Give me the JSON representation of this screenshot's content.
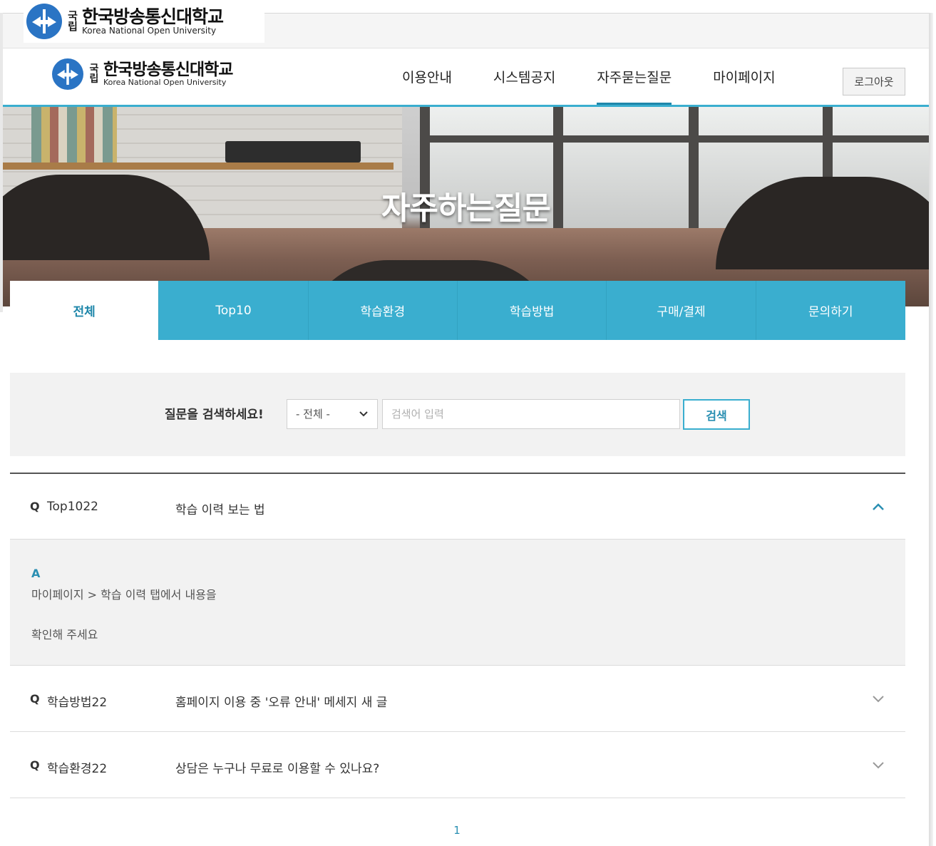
{
  "logo": {
    "korean": "한국방송통신대학교",
    "english": "Korea National Open University",
    "guklip": "국립"
  },
  "nav": {
    "items": [
      "이용안내",
      "시스템공지",
      "자주묻는질문",
      "마이페이지"
    ],
    "active_index": 2,
    "logout_label": "로그아웃"
  },
  "hero": {
    "title": "자주하는질문"
  },
  "tabs": {
    "items": [
      "전체",
      "Top10",
      "학습환경",
      "학습방법",
      "구매/결제",
      "문의하기"
    ],
    "active_index": 0
  },
  "search": {
    "label": "질문을 검색하세요!",
    "select_value": "- 전체 -",
    "placeholder": "검색어 입력",
    "button_label": "검색"
  },
  "faq": {
    "q_marker": "Q",
    "a_marker": "A",
    "items": [
      {
        "category": "Top1022",
        "title": "학습 이력 보는 법",
        "expanded": true,
        "answer_line1": "마이페이지 > 학습 이력 탭에서 내용을",
        "answer_line2": "확인해 주세요"
      },
      {
        "category": "학습방법22",
        "title": "홈페이지 이용 중 '오류 안내' 메세지 새 글",
        "expanded": false
      },
      {
        "category": "학습환경22",
        "title": "상담은 누구나 무료로 이용할 수 있나요?",
        "expanded": false
      }
    ]
  },
  "pagination": {
    "current": "1"
  },
  "colors": {
    "accent": "#3aaecf",
    "accent_dark": "#1f87aa",
    "panel": "#f2f2f2"
  }
}
